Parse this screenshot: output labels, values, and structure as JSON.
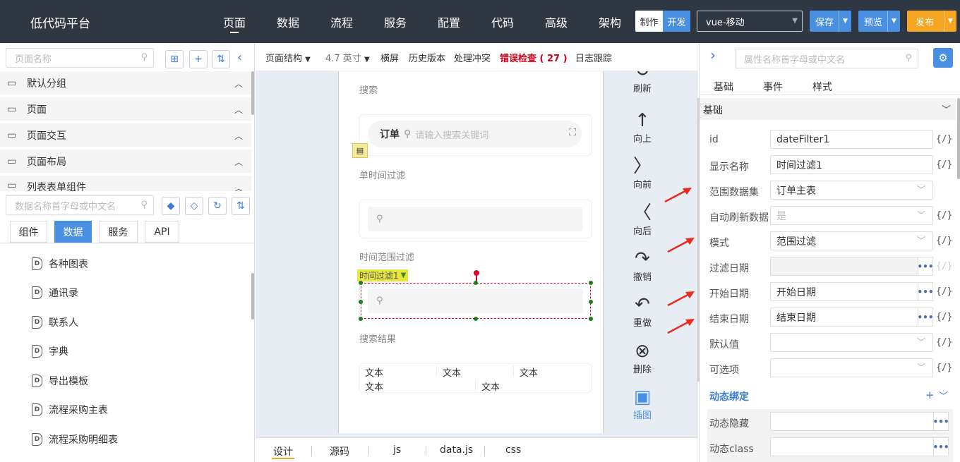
{
  "header": {
    "app_title": "低代码平台",
    "nav": [
      "页面",
      "数据",
      "流程",
      "服务",
      "配置",
      "代码",
      "高级",
      "架构"
    ],
    "mode_make": "制作",
    "mode_dev": "开发",
    "platform": "vue-移动",
    "save": "保存",
    "preview": "预览",
    "publish": "发布"
  },
  "left": {
    "page_search_placeholder": "页面名称",
    "groups": [
      "默认分组",
      "页面",
      "页面交互",
      "页面布局",
      "列表表单组件"
    ],
    "data_search_placeholder": "数据名称首字母或中文名",
    "tabs": [
      "组件",
      "数据",
      "服务",
      "API"
    ],
    "items": [
      "各种图表",
      "通讯录",
      "联系人",
      "字典",
      "导出模板",
      "流程采购主表",
      "流程采购明细表"
    ]
  },
  "toolbar": {
    "structure": "页面结构",
    "size": "4.7 英寸",
    "landscape": "横屏",
    "history": "历史版本",
    "conflict": "处理冲突",
    "error_check": "错误检查 ( 27 )",
    "log": "日志跟踪"
  },
  "canvas": {
    "search_label": "搜索",
    "order_label": "订单",
    "search_placeholder": "请输入搜索关键词",
    "single_time_filter": "单时间过滤",
    "time_range_filter": "时间范围过滤",
    "selected_tag": "时间过滤1",
    "result_label": "搜索结果",
    "text_cell": "文本"
  },
  "canvas_tools": [
    {
      "label": "刷新",
      "icon": "refresh-icon"
    },
    {
      "label": "向上",
      "icon": "arrow-up-icon"
    },
    {
      "label": "向前",
      "icon": "chevron-right-icon"
    },
    {
      "label": "向后",
      "icon": "chevron-left-icon"
    },
    {
      "label": "撤销",
      "icon": "undo-icon"
    },
    {
      "label": "重做",
      "icon": "redo-icon"
    },
    {
      "label": "删除",
      "icon": "delete-icon"
    },
    {
      "label": "插图",
      "icon": "image-icon"
    }
  ],
  "bottom_tabs": [
    "设计",
    "源码",
    "js",
    "data.js",
    "css"
  ],
  "right": {
    "search_placeholder": "属性名称首字母或中文名",
    "tabs": [
      "基础",
      "事件",
      "样式"
    ],
    "section": "基础",
    "props": [
      {
        "label": "id",
        "value": "dateFilter1"
      },
      {
        "label": "显示名称",
        "value": "时间过滤1"
      },
      {
        "label": "范围数据集",
        "value": "订单主表"
      },
      {
        "label": "自动刷新数据",
        "value": "是"
      },
      {
        "label": "模式",
        "value": "范围过滤"
      },
      {
        "label": "过滤日期",
        "value": ""
      },
      {
        "label": "开始日期",
        "value": "开始日期"
      },
      {
        "label": "结束日期",
        "value": "结束日期"
      },
      {
        "label": "默认值",
        "value": ""
      },
      {
        "label": "可选项",
        "value": ""
      }
    ],
    "dynamic_section": "动态绑定",
    "dynamic_props": [
      {
        "label": "动态隐藏",
        "value": ""
      },
      {
        "label": "动态class",
        "value": ""
      }
    ],
    "brace": "{/}"
  },
  "colors": {
    "topbar": "#2f3742",
    "accent": "#4a90e2",
    "publish": "#f5a623",
    "error": "#d0021b"
  }
}
